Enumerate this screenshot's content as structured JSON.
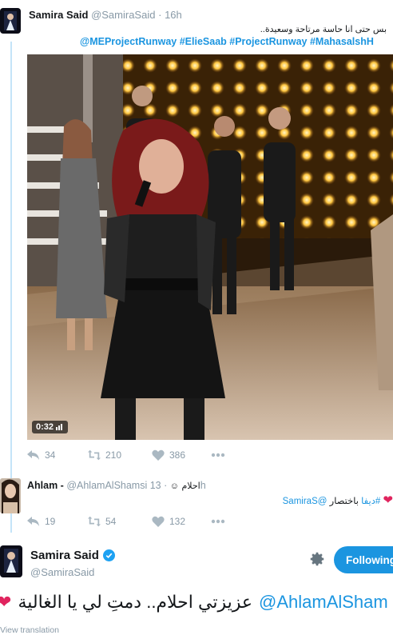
{
  "tweet1": {
    "name": "Samira Said",
    "handle": "@SamiraSaid",
    "dot": "·",
    "time": "16h",
    "text": "بس حتى انا حاسة مرتاحة وسعيدة..",
    "hashtags": "@MEProjectRunway #ElieSaab #ProjectRunway #MahasalshH",
    "video_time": "0:32",
    "reply_count": "34",
    "retweet_count": "210",
    "like_count": "386"
  },
  "tweet2": {
    "name": "Ahlam -",
    "handle": "@AhlamAlShamsi",
    "display_ar": "احلام",
    "dot": "·",
    "time": "13h",
    "mention": "@SamiraS",
    "text_ar": "باختصار",
    "hashtag": "#ديفا",
    "reply_count": "19",
    "retweet_count": "54",
    "like_count": "132"
  },
  "tweet3": {
    "name": "Samira Said",
    "handle": "@SamiraSaid",
    "follow_label": "Following",
    "mention": "@AhlamAlSham",
    "text_ar": "عزيزتي احلام.. دمتِ لي يا الغالية",
    "view_translation": "View translation"
  },
  "icons": {
    "reply": "reply-icon",
    "retweet": "retweet-icon",
    "like": "heart-icon",
    "more": "more-icon",
    "gear": "gear-icon",
    "verified": "verified-badge-icon"
  },
  "colors": {
    "link": "#1b95e0",
    "heart": "#e0245e",
    "muted": "#8899a6",
    "thread": "#c4e4f8"
  }
}
